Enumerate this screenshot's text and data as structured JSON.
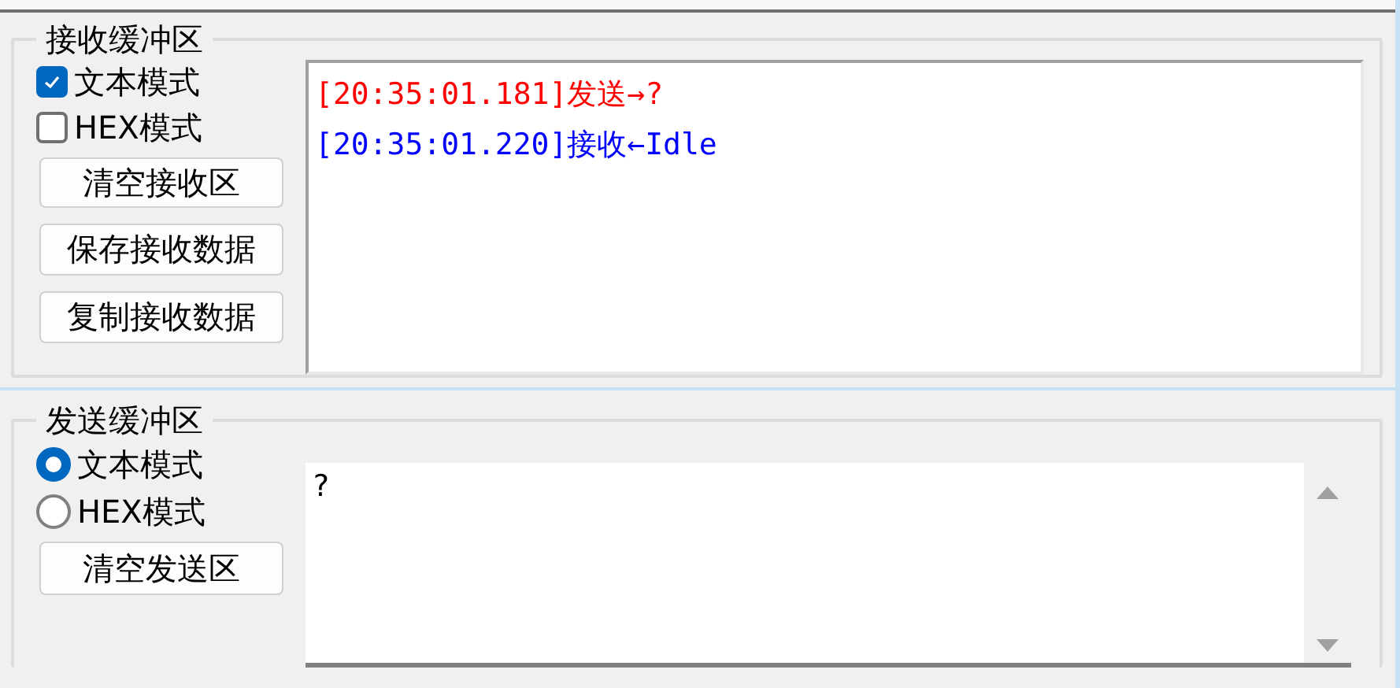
{
  "receive_buffer": {
    "title": "接收缓冲区",
    "options": [
      {
        "label": "文本模式",
        "checked": true
      },
      {
        "label": "HEX模式",
        "checked": false
      }
    ],
    "buttons": [
      "清空接收区",
      "保存接收数据",
      "复制接收数据"
    ],
    "log": [
      {
        "text": "[20:35:01.181]发送→?",
        "color": "#ff0000"
      },
      {
        "text": "[20:35:01.220]接收←Idle",
        "color": "#0000ff"
      }
    ]
  },
  "send_buffer": {
    "title": "发送缓冲区",
    "options": [
      {
        "label": "文本模式",
        "selected": true
      },
      {
        "label": "HEX模式",
        "selected": false
      }
    ],
    "buttons": [
      "清空发送区"
    ],
    "input": {
      "value": "?"
    }
  }
}
